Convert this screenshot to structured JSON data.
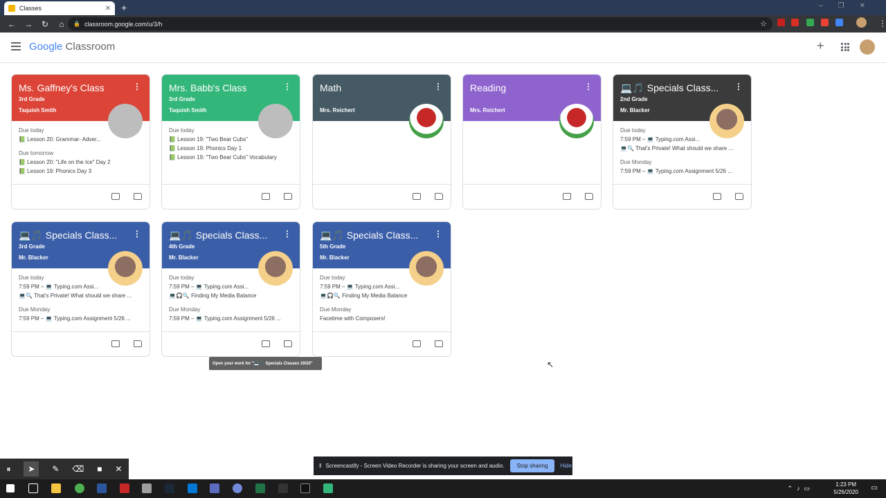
{
  "browser": {
    "tab_title": "Classes",
    "url": "classroom.google.com/u/3/h"
  },
  "header": {
    "logo_google": "Google",
    "logo_product": "Classroom"
  },
  "cards": [
    {
      "title": "Ms. Gaffney's Class",
      "section": "3rd Grade",
      "teacher": "Taquish Smith",
      "color": "#db4437",
      "body": [
        {
          "label": "Due today",
          "lines": [
            "📗 Lesson 20: Grammar- Adver..."
          ]
        },
        {
          "label": "Due tomorrow",
          "lines": [
            "📗 Lesson 20: \"Life on the Ice\" Day 2",
            "📗 Lesson 19: Phonics Day 3"
          ]
        }
      ]
    },
    {
      "title": "Mrs. Babb's Class",
      "section": "3rd Grade",
      "teacher": "Taquish Smith",
      "color": "#33b679",
      "body": [
        {
          "label": "Due today",
          "lines": [
            "📗 Lesson 19: \"Two Bear Cubs\"",
            "📗 Lesson 19: Phonics Day 1",
            "📗 Lesson 19: \"Two Bear Cubs\" Vocabulary"
          ]
        }
      ]
    },
    {
      "title": "Math",
      "section": "",
      "teacher": "Mrs. Reichert",
      "color": "#455a64",
      "body": []
    },
    {
      "title": "Reading",
      "section": "",
      "teacher": "Mrs. Reichert",
      "color": "#8e63ce",
      "body": []
    },
    {
      "title": "💻🎵 Specials Class...",
      "section": "2nd Grade",
      "teacher": "Mr. Blacker",
      "color": "#3b3b3b",
      "body": [
        {
          "label": "Due today",
          "lines": [
            "7:59 PM – 💻 Typing.com Assi...",
            "💻🔍 That's Private! What should we share ..."
          ]
        },
        {
          "label": "Due Monday",
          "lines": [
            "7:59 PM – 💻 Typing.com Assignment 5/26 ..."
          ]
        }
      ]
    },
    {
      "title": "💻🎵 Specials Class...",
      "section": "3rd Grade",
      "teacher": "Mr. Blacker",
      "color": "#3b5ea8",
      "body": [
        {
          "label": "Due today",
          "lines": [
            "7:59 PM – 💻 Typing.com Assi...",
            "💻🔍 That's Private! What should we share ..."
          ]
        },
        {
          "label": "Due Monday",
          "lines": [
            "7:59 PM – 💻 Typing.com Assignment 5/26 ..."
          ]
        }
      ]
    },
    {
      "title": "💻🎵 Specials Class...",
      "section": "4th Grade",
      "teacher": "Mr. Blacker",
      "color": "#3b5ea8",
      "body": [
        {
          "label": "Due today",
          "lines": [
            "7:59 PM – 💻 Typing.com Assi...",
            "💻🎧🔍 Finding My Media Balance"
          ]
        },
        {
          "label": "Due Monday",
          "lines": [
            "7:59 PM – 💻 Typing.com Assignment 5/26 ..."
          ]
        }
      ]
    },
    {
      "title": "💻🎵 Specials Class...",
      "section": "5th Grade",
      "teacher": "Mr. Blacker",
      "color": "#3b5ea8",
      "body": [
        {
          "label": "Due today",
          "lines": [
            "7:59 PM – 💻 Typing.com Assi...",
            "💻🎧🔍 Finding My Media Balance"
          ]
        },
        {
          "label": "Due Monday",
          "lines": [
            "Facetime with Composers!"
          ]
        }
      ]
    }
  ],
  "tooltip": "Open your work for \"💻🎵 Specials Classes 19/20\"",
  "share_bar": {
    "message": "Screencastify - Screen Video Recorder is sharing your screen and audio.",
    "stop_label": "Stop sharing",
    "hide_label": "Hide"
  },
  "taskbar": {
    "time": "1:23 PM",
    "date": "5/26/2020"
  }
}
